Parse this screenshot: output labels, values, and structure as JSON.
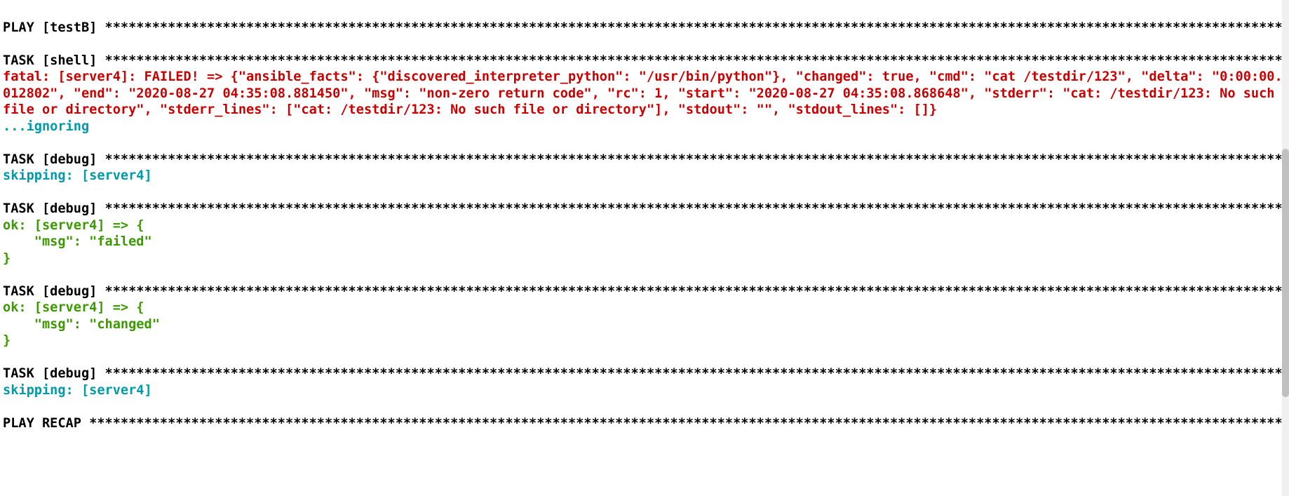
{
  "lines": [
    {
      "cls": "black",
      "text": ""
    },
    {
      "cls": "black",
      "text": "PLAY [testB] ******************************************************************************************************************************************************"
    },
    {
      "cls": "black",
      "text": ""
    },
    {
      "cls": "black",
      "text": "TASK [shell] ******************************************************************************************************************************************************"
    },
    {
      "cls": "red",
      "text": "fatal: [server4]: FAILED! => {\"ansible_facts\": {\"discovered_interpreter_python\": \"/usr/bin/python\"}, \"changed\": true, \"cmd\": \"cat /testdir/123\", \"delta\": \"0:00:00.012802\", \"end\": \"2020-08-27 04:35:08.881450\", \"msg\": \"non-zero return code\", \"rc\": 1, \"start\": \"2020-08-27 04:35:08.868648\", \"stderr\": \"cat: /testdir/123: No such file or directory\", \"stderr_lines\": [\"cat: /testdir/123: No such file or directory\"], \"stdout\": \"\", \"stdout_lines\": []}"
    },
    {
      "cls": "cyan",
      "text": "...ignoring"
    },
    {
      "cls": "black",
      "text": ""
    },
    {
      "cls": "black",
      "text": "TASK [debug] ******************************************************************************************************************************************************"
    },
    {
      "cls": "cyan",
      "text": "skipping: [server4]"
    },
    {
      "cls": "black",
      "text": ""
    },
    {
      "cls": "black",
      "text": "TASK [debug] ******************************************************************************************************************************************************"
    },
    {
      "cls": "green",
      "text": "ok: [server4] => {"
    },
    {
      "cls": "green",
      "text": "    \"msg\": \"failed\""
    },
    {
      "cls": "green",
      "text": "}"
    },
    {
      "cls": "black",
      "text": ""
    },
    {
      "cls": "black",
      "text": "TASK [debug] ******************************************************************************************************************************************************"
    },
    {
      "cls": "green",
      "text": "ok: [server4] => {"
    },
    {
      "cls": "green",
      "text": "    \"msg\": \"changed\""
    },
    {
      "cls": "green",
      "text": "}"
    },
    {
      "cls": "black",
      "text": ""
    },
    {
      "cls": "black",
      "text": "TASK [debug] ******************************************************************************************************************************************************"
    },
    {
      "cls": "cyan",
      "text": "skipping: [server4]"
    },
    {
      "cls": "black",
      "text": ""
    },
    {
      "cls": "black",
      "text": "PLAY RECAP ********************************************************************************************************************************************************"
    }
  ]
}
